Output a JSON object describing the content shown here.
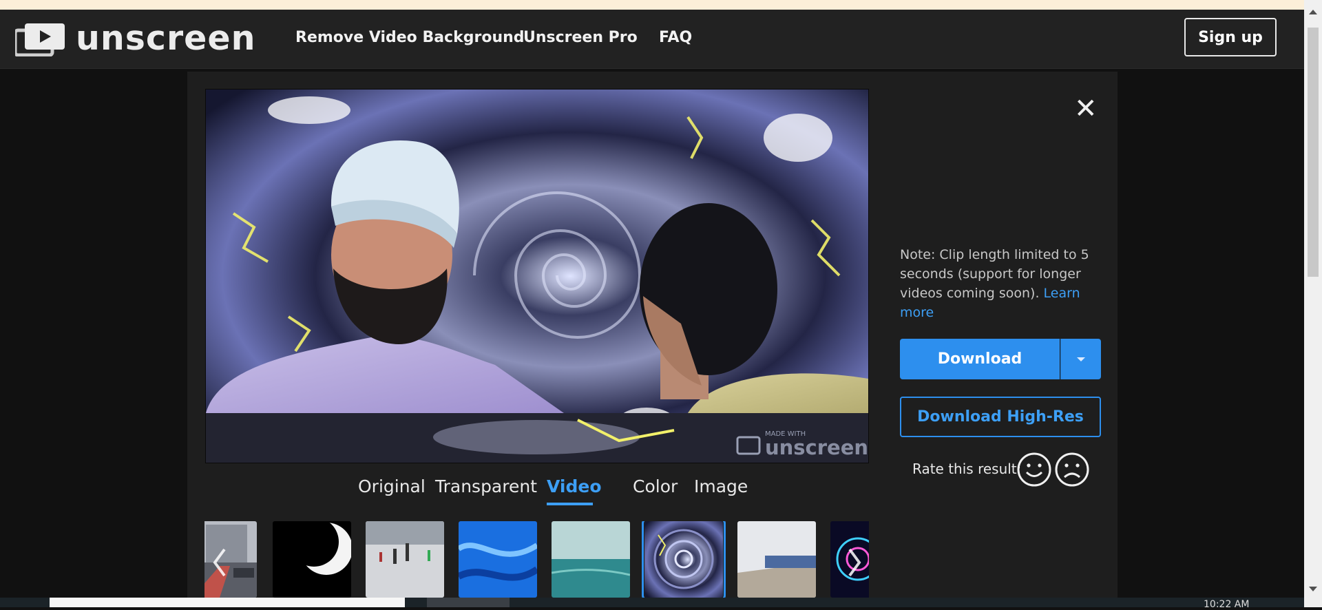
{
  "brand": {
    "name": "unscreen"
  },
  "nav": {
    "links": [
      "Remove Video Background",
      "Unscreen Pro",
      "FAQ"
    ],
    "signup_label": "Sign up"
  },
  "editor": {
    "close_symbol": "✕",
    "watermark": {
      "small": "MADE WITH",
      "big": "unscreen"
    },
    "note_text": "Note: Clip length limited to 5 seconds (support for longer videos coming soon).",
    "note_link": "Learn more",
    "download_label": "Download",
    "download_hires_label": "Download High-Res",
    "rate_label": "Rate this result:",
    "tabs": [
      "Original",
      "Transparent",
      "Video",
      "Color",
      "Image"
    ],
    "active_tab": "Video",
    "background_thumbnails": [
      "street",
      "moon-crescent",
      "ice-rink",
      "blue-marble",
      "ocean",
      "vortex",
      "train-coast",
      "kaleidoscope"
    ],
    "selected_thumbnail": "vortex"
  },
  "taskbar": {
    "clock": "10:22 AM"
  },
  "colors": {
    "accent": "#2d8fee",
    "nav_bg": "#222222",
    "panel_bg": "#1e1e1e",
    "page_bg": "#111111",
    "top_strip": "#fcefd8"
  }
}
